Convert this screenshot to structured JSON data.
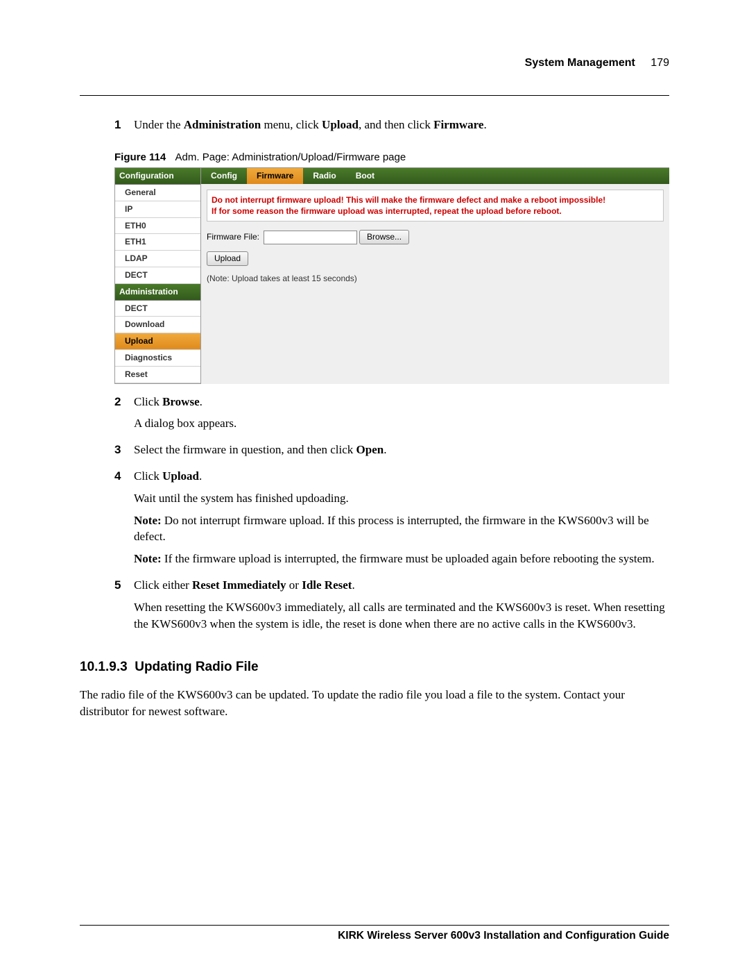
{
  "header": {
    "title": "System Management",
    "page_number": "179"
  },
  "steps": {
    "s1": {
      "num": "1",
      "pre": "Under the ",
      "b1": "Administration",
      "mid1": " menu, click ",
      "b2": "Upload",
      "mid2": ", and then click ",
      "b3": "Firmware",
      "post": "."
    },
    "s2": {
      "num": "2",
      "pre": "Click ",
      "b1": "Browse",
      "post": ".",
      "after": "A dialog box appears."
    },
    "s3": {
      "num": "3",
      "pre": "Select the firmware in question, and then click ",
      "b1": "Open",
      "post": "."
    },
    "s4": {
      "num": "4",
      "pre": "Click ",
      "b1": "Upload",
      "post": ".",
      "after": "Wait until the system has finished updoading.",
      "note1_b": "Note:",
      "note1": " Do not interrupt firmware upload. If this process is interrupted, the firmware in the KWS600v3 will be defect.",
      "note2_b": "Note:",
      "note2": " If the firmware upload is interrupted, the firmware must be uploaded again before rebooting the system."
    },
    "s5": {
      "num": "5",
      "pre": "Click either ",
      "b1": "Reset Immediately",
      "mid1": " or ",
      "b2": "Idle Reset",
      "post": ".",
      "after": "When resetting the KWS600v3 immediately, all calls are terminated and the KWS600v3 is reset. When resetting the KWS600v3 when the system is idle, the reset is done when there are no active calls in the KWS600v3."
    }
  },
  "figure": {
    "num": "Figure 114",
    "caption": "Adm. Page: Administration/Upload/Firmware page"
  },
  "ui": {
    "sidebar": {
      "h1": "Configuration",
      "c_items": {
        "0": "General",
        "1": "IP",
        "2": "ETH0",
        "3": "ETH1",
        "4": "LDAP",
        "5": "DECT"
      },
      "h2": "Administration",
      "a_items": {
        "0": "DECT",
        "1": "Download",
        "2": "Upload",
        "3": "Diagnostics",
        "4": "Reset"
      }
    },
    "tabs": {
      "0": "Config",
      "1": "Firmware",
      "2": "Radio",
      "3": "Boot"
    },
    "warn1": "Do not interrupt firmware upload! This will make the firmware defect and make a reboot impossible!",
    "warn2": "If for some reason the firmware upload was interrupted, repeat the upload before reboot.",
    "form": {
      "label": "Firmware File:",
      "browse": "Browse...",
      "upload": "Upload",
      "note": "(Note: Upload takes at least 15 seconds)"
    }
  },
  "section": {
    "num": "10.1.9.3",
    "title": "Updating Radio File",
    "body": "The radio file of the KWS600v3 can be updated. To update the radio file you load a file to the system. Contact your distributor for newest software."
  },
  "footer": "KIRK Wireless Server 600v3 Installation and Configuration Guide"
}
